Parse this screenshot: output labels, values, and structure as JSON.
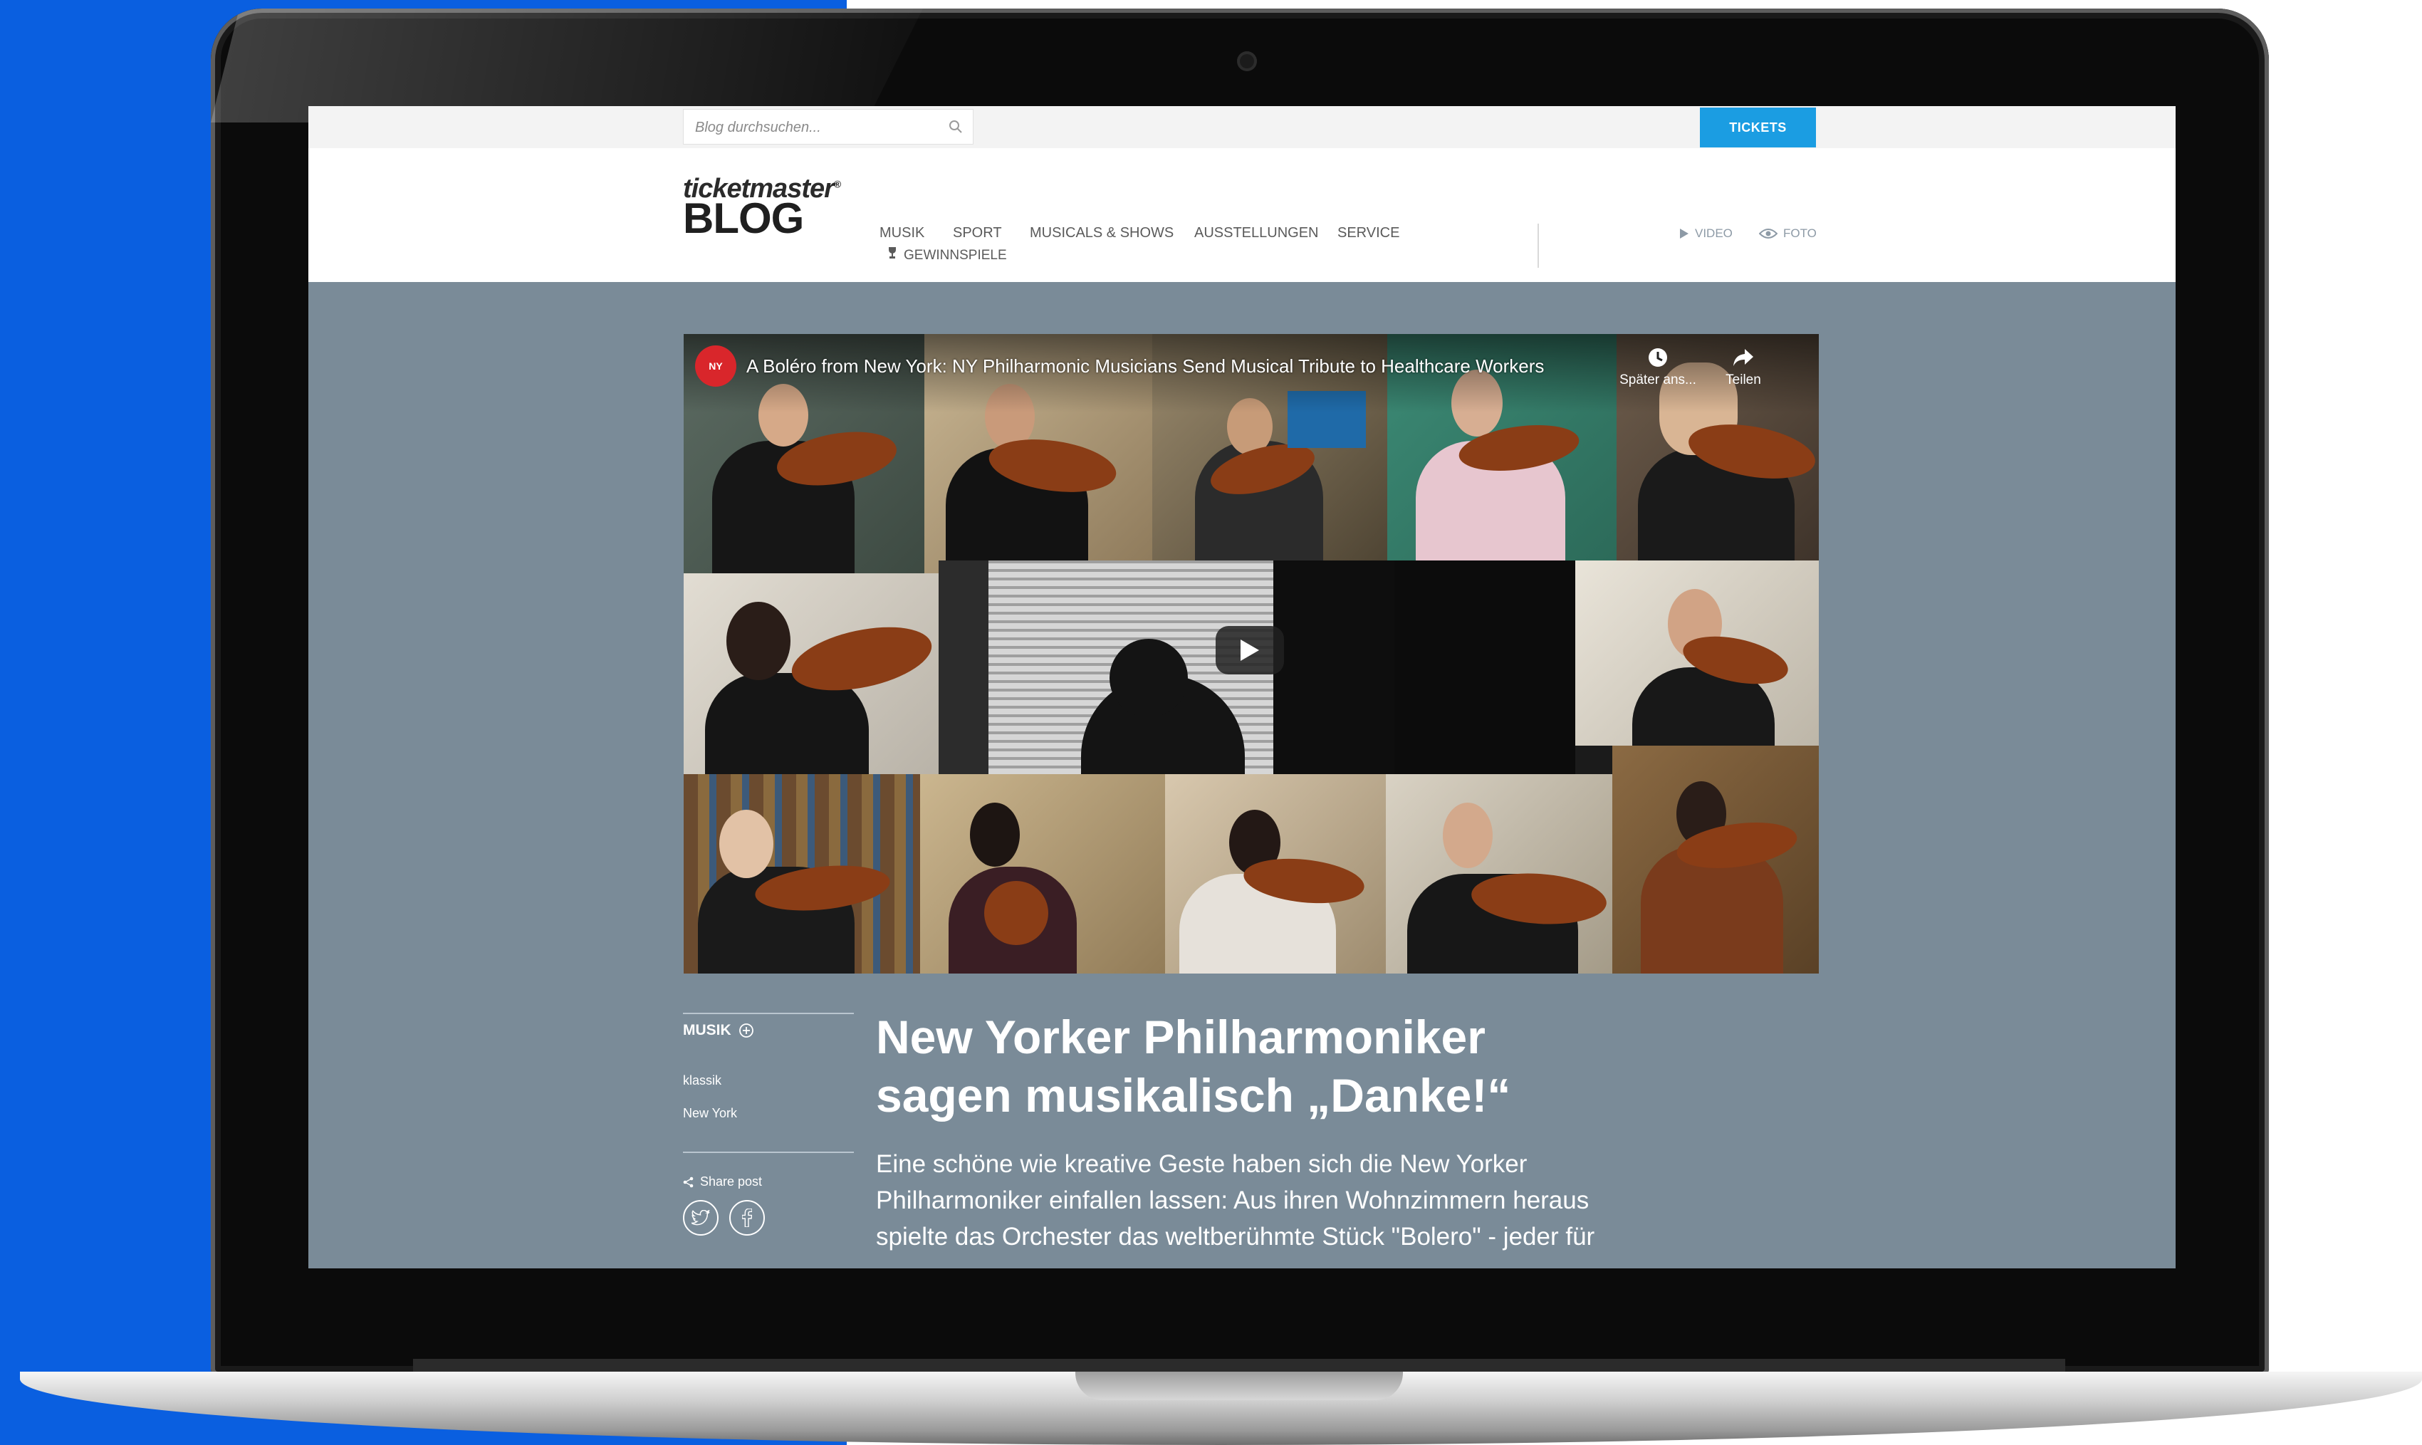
{
  "blog": {
    "search_placeholder": "Blog durchsuchen...",
    "tickets_label": "TICKETS",
    "logo_brand": "ticketmaster",
    "logo_blog": "BLOG",
    "nav": {
      "musik": "MUSIK",
      "sport": "SPORT",
      "musicals": "MUSICALS & SHOWS",
      "ausstellungen": "AUSSTELLUNGEN",
      "service": "SERVICE",
      "gewinnspiele": "GEWINNSPIELE"
    },
    "media": {
      "video": "VIDEO",
      "foto": "FOTO"
    }
  },
  "video": {
    "title": "A Boléro from New York: NY Philharmonic Musicians Send Musical Tribute to Healthcare Workers",
    "watch_later": "Später ans...",
    "share": "Teilen"
  },
  "article": {
    "category": "MUSIK",
    "tags": [
      "klassik",
      "New York"
    ],
    "share_label": "Share post",
    "headline_line1": "New Yorker Philharmoniker",
    "headline_line2": "sagen musikalisch „Danke!“",
    "lead_line1": "Eine schöne wie kreative Geste haben sich die New Yorker",
    "lead_line2": "Philharmoniker einfallen lassen: Aus ihren Wohnzimmern heraus",
    "lead_line3": "spielte das Orchester das weltberühmte Stück \"Bolero\" - jeder für"
  },
  "colors": {
    "page_background": "#0a5fe0",
    "blog_background": "#7a8b98",
    "tickets_button": "#1b9de2",
    "youtube_red": "#d9262b"
  }
}
